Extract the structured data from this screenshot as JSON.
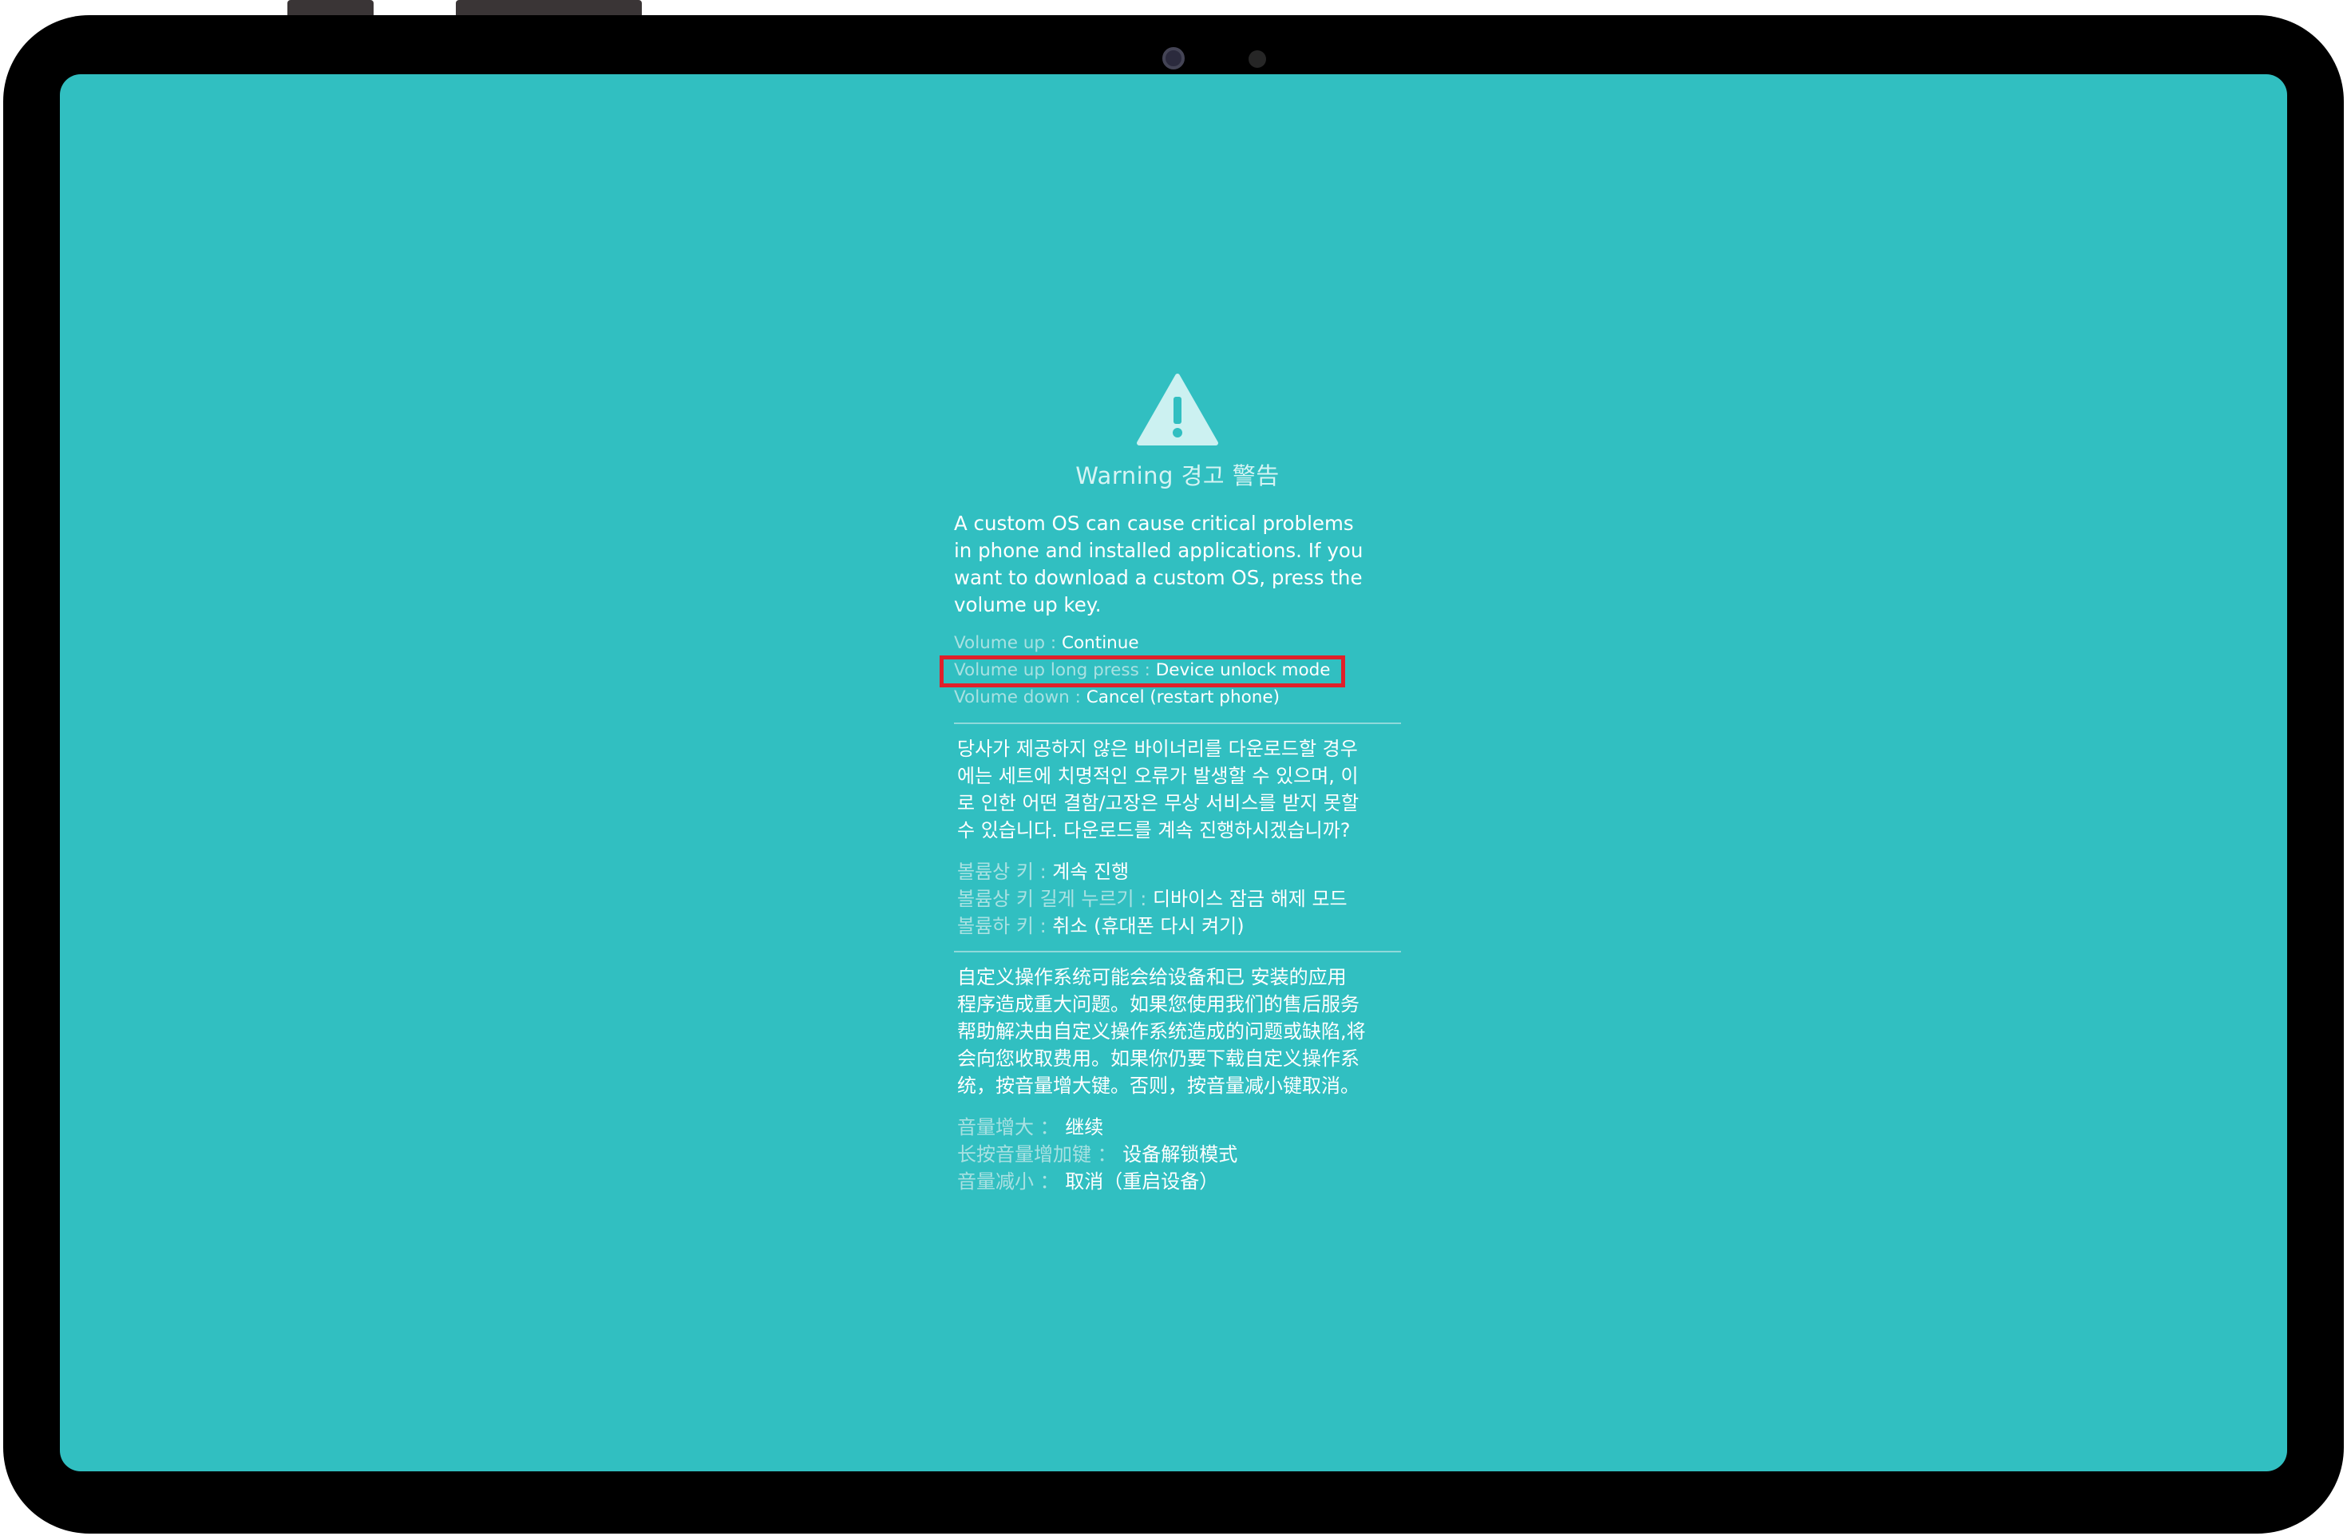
{
  "screen": {
    "background_color": "#31bfc1",
    "highlight_color": "#e0202a"
  },
  "warning": {
    "icon": "warning-triangle-icon",
    "title": "Warning 경고 警告"
  },
  "english": {
    "paragraph": "A custom OS can cause critical problems\nin phone and installed applications. If you\nwant to download a custom OS, press the\nvolume up key.",
    "keys": [
      {
        "label": "Volume up : ",
        "value": "Continue"
      },
      {
        "label": "Volume up long press : ",
        "value": "Device unlock mode"
      },
      {
        "label": "Volume down : ",
        "value": "Cancel (restart phone)"
      }
    ]
  },
  "korean": {
    "paragraph": "당사가 제공하지 않은 바이너리를 다운로드할 경우\n에는 세트에 치명적인 오류가 발생할 수 있으며, 이\n로 인한 어떤 결함/고장은 무상 서비스를 받지 못할\n수 있습니다. 다운로드를 계속 진행하시겠습니까?",
    "keys": [
      {
        "label": "볼륨상 키 : ",
        "value": "계속 진행"
      },
      {
        "label": "볼륨상 키 길게 누르기 : ",
        "value": "디바이스 잠금 해제 모드"
      },
      {
        "label": "볼륨하 키 : ",
        "value": "취소 (휴대폰 다시 켜기)"
      }
    ]
  },
  "chinese": {
    "paragraph": "自定义操作系统可能会给设备和已 安装的应用\n程序造成重大问题。如果您使用我们的售后服务\n帮助解决由自定义操作系统造成的问题或缺陷,将\n会向您收取费用。如果你仍要下载自定义操作系\n统，按音量增大键。否则，按音量减小键取消。",
    "keys": [
      {
        "label": "音量增大 ： ",
        "value": "继续"
      },
      {
        "label": "长按音量增加键 ： ",
        "value": "设备解锁模式"
      },
      {
        "label": "音量减小 ： ",
        "value": "取消（重启设备）"
      }
    ]
  }
}
